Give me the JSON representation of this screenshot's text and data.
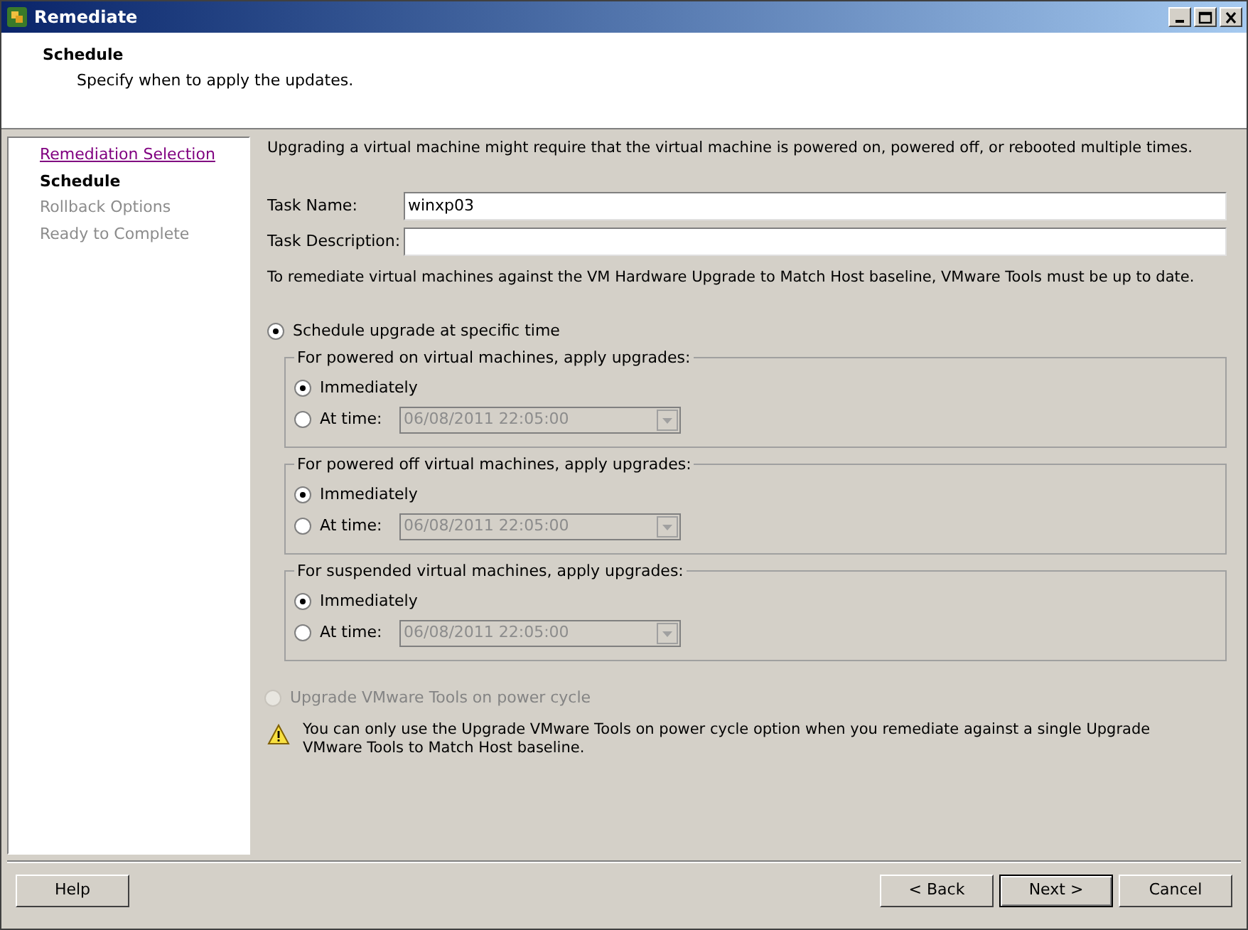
{
  "window": {
    "title": "Remediate"
  },
  "header": {
    "title": "Schedule",
    "subtitle": "Specify when to apply the updates."
  },
  "steps": [
    {
      "label": "Remediation Selection",
      "visited": true,
      "selected": false
    },
    {
      "label": "Schedule",
      "selected": true
    },
    {
      "label": "Rollback Options",
      "visited": false,
      "selected": false
    },
    {
      "label": "Ready to Complete",
      "visited": false,
      "selected": false
    }
  ],
  "intro": "Upgrading a virtual machine might require that the virtual machine is powered on, powered off, or rebooted multiple times.",
  "fields": [
    {
      "label": "Task Name:",
      "value": "winxp03"
    },
    {
      "label": "Task Description:"
    }
  ],
  "note": "To remediate virtual machines against the VM Hardware Upgrade to Match Host baseline, VMware Tools must be up to date.",
  "schedule_option": {
    "label": "Schedule upgrade at specific time",
    "selected": true
  },
  "groups": [
    {
      "title": "For powered on virtual machines, apply upgrades:",
      "options": [
        {
          "label": "Immediately",
          "selected": true
        },
        {
          "label": "At time:",
          "selected": false
        }
      ],
      "time": "06/08/2011 22:05:00",
      "time_disabled": true
    },
    {
      "title": "For powered off virtual machines, apply upgrades:",
      "options": [
        {
          "label": "Immediately",
          "selected": true
        },
        {
          "label": "At time:",
          "selected": false
        }
      ],
      "time": "06/08/2011 22:05:00",
      "time_disabled": true
    },
    {
      "title": "For suspended virtual machines, apply upgrades:",
      "options": [
        {
          "label": "Immediately",
          "selected": true
        },
        {
          "label": "At time:",
          "selected": false
        }
      ],
      "time": "06/08/2011 22:05:00",
      "time_disabled": true
    }
  ],
  "power_cycle_option": {
    "label": "Upgrade VMware Tools on power cycle",
    "selected": false,
    "disabled": true
  },
  "warning": "You can only use the Upgrade VMware Tools on power cycle option when you remediate against a single Upgrade VMware Tools to Match Host baseline.",
  "buttons": [
    {
      "label": "Help",
      "kind": "left",
      "default": false
    },
    {
      "label": "< Back",
      "kind": "right",
      "default": false
    },
    {
      "label": "Next >",
      "kind": "right",
      "default": true
    },
    {
      "label": "Cancel",
      "kind": "right",
      "default": false
    }
  ]
}
